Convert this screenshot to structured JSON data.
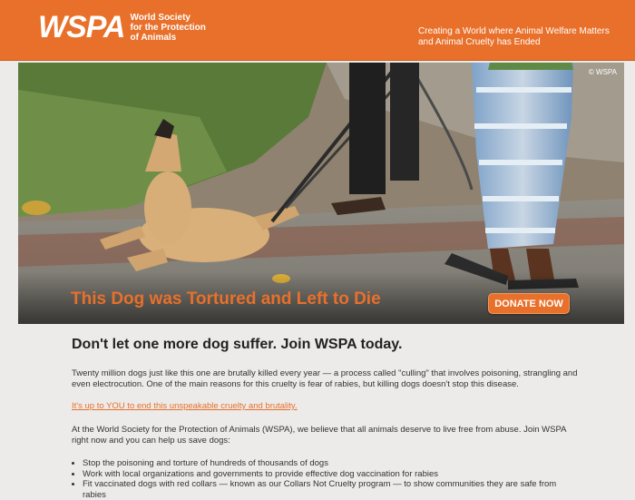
{
  "header": {
    "logo_text": "WSPA",
    "org_line1": "World Society",
    "org_line2": "for the Protection",
    "org_line3": "of Animals",
    "tagline": "Creating a World where Animal Welfare Matters and Animal Cruelty has Ended",
    "background_color": "#e8702a"
  },
  "hero": {
    "copyright": "© WSPA",
    "headline": "This Dog was Tortured and Left to Die",
    "donate_label": "DONATE NOW",
    "accent_color": "#e8702a"
  },
  "content": {
    "headline": "Don't let one more dog suffer. Join WSPA today.",
    "paragraph1": "Twenty million dogs just like this one are brutally killed every year — a process called \"culling\" that involves poisoning, strangling and even electrocution. One of the main reasons for this cruelty is fear of rabies, but killing dogs doesn't stop this disease.",
    "link_text": "It's up to YOU to end this unspeakable cruelty and brutality.",
    "paragraph2": "At the World Society for the Protection of Animals (WSPA), we believe that all animals deserve to live free from abuse. Join WSPA right now and you can help us save dogs:",
    "bullets": [
      "Stop the poisoning and torture of hundreds of thousands of dogs",
      "Work with local organizations and governments to provide effective dog vaccination for rabies",
      "Fit vaccinated dogs with red collars — known as our Collars Not Cruelty program — to show communities they are safe from rabies"
    ]
  }
}
